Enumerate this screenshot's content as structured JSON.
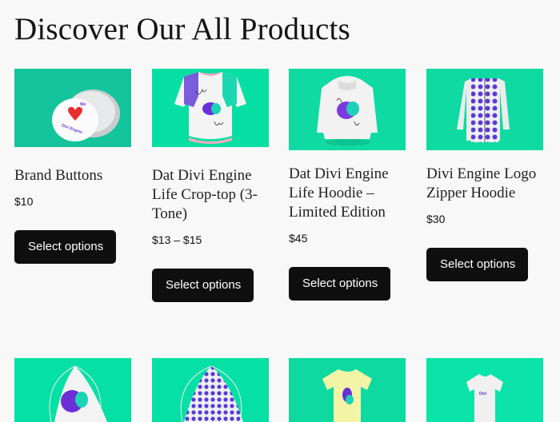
{
  "page": {
    "title": "Discover Our All Products"
  },
  "products": [
    {
      "name": "Brand Buttons",
      "price": "$10",
      "button": "Select options",
      "image": "brand-buttons-image",
      "bg": "#14c49b"
    },
    {
      "name": "Dat Divi Engine Life Crop-top (3-Tone)",
      "price": "$13 – $15",
      "button": "Select options",
      "image": "crop-top-image",
      "bg": "#06dfa4"
    },
    {
      "name": "Dat Divi Engine Life Hoodie – Limited Edition",
      "price": "$45",
      "button": "Select options",
      "image": "hoodie-image",
      "bg": "#0fdaa2"
    },
    {
      "name": "Divi Engine Logo Zipper Hoodie",
      "price": "$30",
      "button": "Select options",
      "image": "zipper-hoodie-image",
      "bg": "#0fdaa2"
    }
  ],
  "products_row2": [
    {
      "image": "drawstring-bag-image",
      "bg": "#05e0a5"
    },
    {
      "image": "patterned-bag-image",
      "bg": "#05e0a5"
    },
    {
      "image": "yellow-tshirt-image",
      "bg": "#0ed9a1"
    },
    {
      "image": "white-tshirt-image",
      "bg": "#0ae3a9"
    }
  ]
}
